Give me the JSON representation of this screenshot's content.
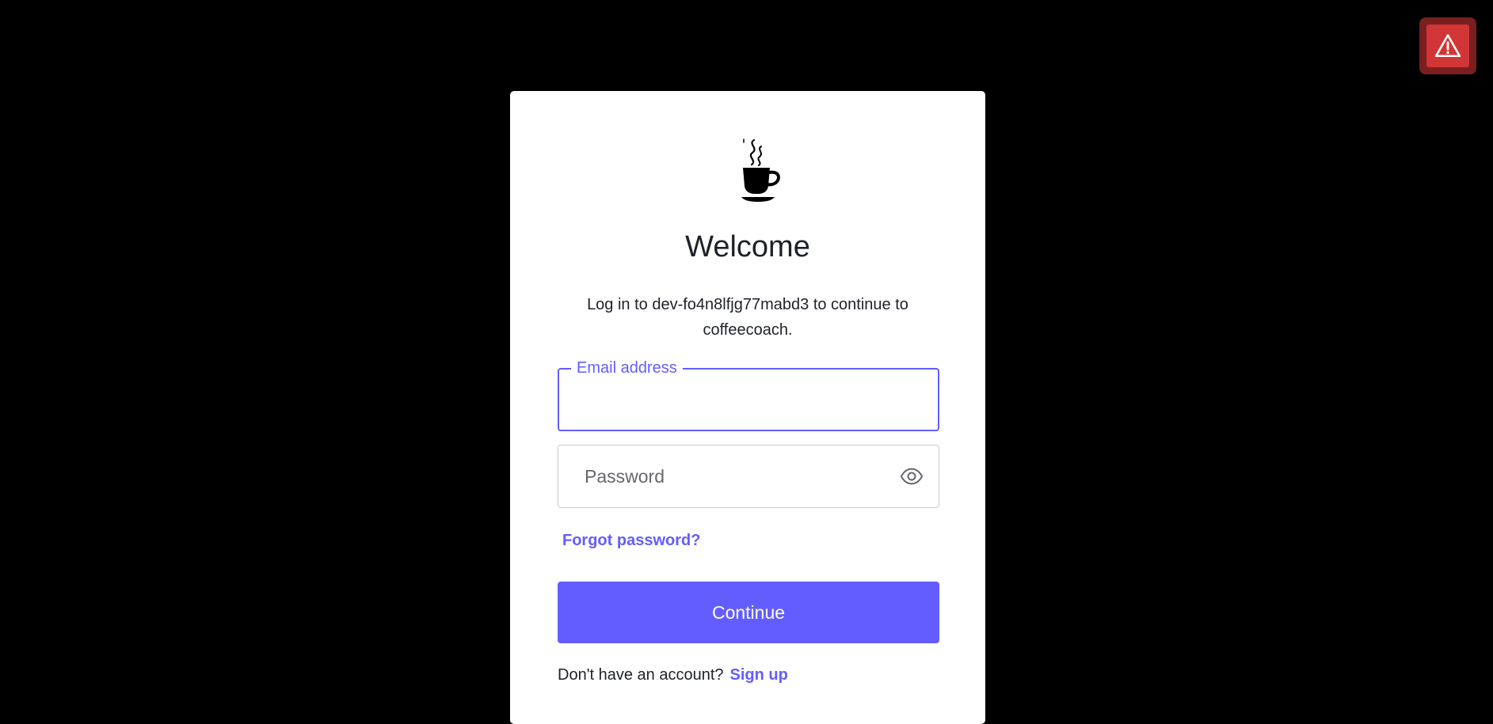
{
  "alert": {
    "icon": "warning-triangle-icon",
    "color": "#d13535"
  },
  "login": {
    "logo_icon": "coffee-cup-icon",
    "title": "Welcome",
    "subtitle": "Log in to dev-fo4n8lfjg77mabd3 to continue to coffeecoach.",
    "email": {
      "label": "Email address",
      "value": ""
    },
    "password": {
      "placeholder": "Password",
      "toggle_icon": "eye-icon"
    },
    "forgot_password": "Forgot password?",
    "continue_label": "Continue",
    "signup_prompt": "Don't have an account?",
    "signup_link": "Sign up"
  },
  "colors": {
    "accent": "#635dff",
    "background": "#000000",
    "card": "#ffffff",
    "text": "#1e212a"
  }
}
